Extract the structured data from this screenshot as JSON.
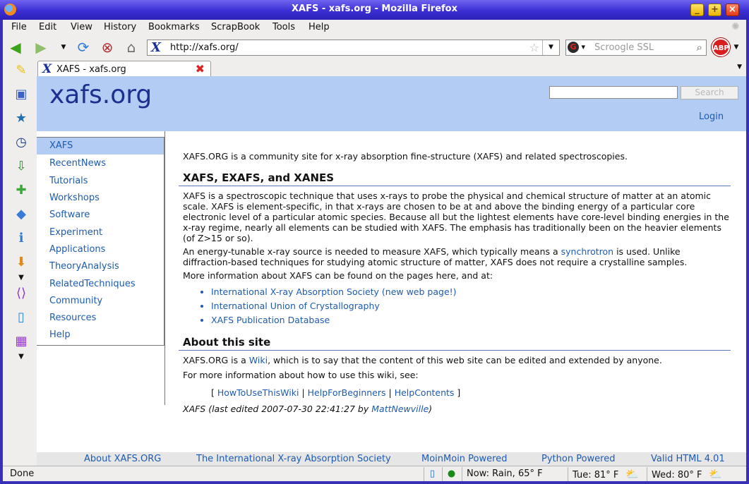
{
  "window": {
    "title": "XAFS - xafs.org - Mozilla Firefox",
    "controls": [
      "_",
      "+",
      "×"
    ]
  },
  "menu": [
    "File",
    "Edit",
    "View",
    "History",
    "Bookmarks",
    "ScrapBook",
    "Tools",
    "Help"
  ],
  "navbar": {
    "url": "http://xafs.org/",
    "search_placeholder": "Scroogle SSL",
    "abp_label": "ABP"
  },
  "tab": {
    "label": "XAFS - xafs.org"
  },
  "site": {
    "logo": "xafs.org",
    "search_button": "Search",
    "login": "Login",
    "nav": [
      "XAFS",
      "RecentNews",
      "Tutorials",
      "Workshops",
      "Software",
      "Experiment",
      "Applications",
      "TheoryAnalysis",
      "RelatedTechniques",
      "Community",
      "Resources",
      "Help"
    ]
  },
  "content": {
    "intro": "XAFS.ORG is a community site for x-ray absorption fine-structure (XAFS) and related spectroscopies.",
    "section1_title": "XAFS, EXAFS, and XANES",
    "p1": "XAFS is a spectroscopic technique that uses x-rays to probe the physical and chemical structure of matter at an atomic scale. XAFS is element-specific, in that x-rays are chosen to be at and above the binding energy of a particular core electronic level of a particular atomic species. Because all but the lightest elements have core-level binding energies in the x-ray regime, nearly all elements can be studied with XAFS. The emphasis has traditionally been on the heavier elements (of Z>15 or so).",
    "p2_before": "An energy-tunable x-ray source is needed to measure XAFS, which typically means a ",
    "p2_link": "synchrotron",
    "p2_after": " is used. Unlike diffraction-based techniques for studying atomic structure of matter, XAFS does not require a crystalline samples.",
    "p3": "More information about XAFS can be found on the pages here, and at:",
    "links": [
      "International X-ray Absorption Society (new web page!)",
      "International Union of Crystallography",
      "XAFS Publication Database"
    ],
    "section2_title": "About this site",
    "p4_before": "XAFS.ORG is a ",
    "p4_link": "Wiki",
    "p4_after": ", which is to say that the content of this web site can be edited and extended by anyone.",
    "p5": "For more information about how to use this wiki, see:",
    "help_links": [
      "HowToUseThisWiki",
      "HelpForBeginners",
      "HelpContents"
    ],
    "edited_prefix": "XAFS (last edited 2007-07-30 22:41:27 by ",
    "edited_user": "MattNewville",
    "edited_suffix": ")"
  },
  "footer": [
    "About XAFS.ORG",
    "The International X-ray Absorption Society",
    "MoinMoin Powered",
    "Python Powered",
    "Valid HTML 4.01"
  ],
  "status": {
    "text": "Done",
    "now": "Now: Rain, 65° F",
    "tue": "Tue: 81° F",
    "wed": "Wed: 80° F"
  },
  "colors": {
    "title_bar": "#3b2ed2",
    "header_bg": "#b3ccf4",
    "link": "#1e5bb0",
    "logo": "#1d2f8f"
  }
}
